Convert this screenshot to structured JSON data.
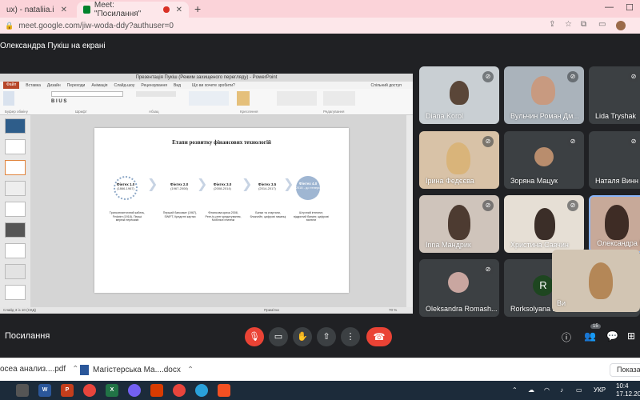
{
  "browser": {
    "tabs": [
      {
        "label": "ux) - nataliia.ilnytska@"
      },
      {
        "label": "Meet: \"Посилання\""
      }
    ],
    "url": "meet.google.com/jiw-woda-ddy?authuser=0"
  },
  "meet": {
    "presenter_label": "Олександра Пукіш на екрані",
    "meeting_name": "Посилання",
    "people_count": "15"
  },
  "powerpoint": {
    "window_title": "Презентація Пукіш (Режим захищеного перегляду) - PowerPoint",
    "tabs": [
      "Файл",
      "Вставка",
      "Дизайн",
      "Переходи",
      "Анімація",
      "Слайд-шоу",
      "Рецензування",
      "Вид"
    ],
    "tell_me": "Що ви хочете зробити?",
    "share_label": "Спільний доступ",
    "ribbon_groups": [
      "Буфер обміну",
      "Шрифт",
      "Абзац",
      "Креслення",
      "Редагування"
    ],
    "slide_title": "Етапи розвитку фінансових технологій",
    "phases": [
      {
        "name": "Фінтех 1.0",
        "years": "(1866-1967)"
      },
      {
        "name": "Фінтех 2.0",
        "years": "(1967-2008)"
      },
      {
        "name": "Фінтех 3.0",
        "years": "(2008-2014)"
      },
      {
        "name": "Фінтех 3.5",
        "years": "(2014-2017)"
      },
      {
        "name": "Фінтех 4.0",
        "years": "(2018 - до теперь)"
      }
    ],
    "descriptions": [
      "Трансатлантичний кабель, Fedwire (1918), Перші мережі переказів",
      "Перший банкомат (1967), SWIFT, Кредитні картки",
      "Фінансова криза 2008, Peer-to-peer кредитування, Мобільні платежі",
      "Банки та стартапи, блокчейн, цифрові гаманці",
      "Штучний інтелект, відкритий банкінг, цифрові валюти"
    ],
    "status_left": "Слайд 3 із 10 (СКД)",
    "status_right": "Примітки",
    "zoom": "70 %"
  },
  "participants": [
    {
      "name": "Diana Korol",
      "muted": true
    },
    {
      "name": "Вульчин Роман Дм...",
      "muted": true
    },
    {
      "name": "Lida Tryshak",
      "muted": true
    },
    {
      "name": "Ірина Федєєва",
      "muted": true
    },
    {
      "name": "Зоряна Мацук",
      "muted": true
    },
    {
      "name": "Наталя Винн",
      "muted": true
    },
    {
      "name": "Іnna Мандрик",
      "muted": true
    },
    {
      "name": "Христина Савчин",
      "muted": true
    },
    {
      "name": "Олександра П",
      "muted": false
    },
    {
      "name": "Oleksandra Romash...",
      "muted": true
    },
    {
      "name": "Rorksolyana L",
      "muted": true,
      "initial": "R"
    },
    {
      "name": "Ви",
      "muted": false
    }
  ],
  "downloads": [
    {
      "label": "ocea анализ....pdf"
    },
    {
      "label": "Магістерська Ма....docx"
    }
  ],
  "downloads_show_all": "Показати",
  "taskbar": {
    "lang": "УКР",
    "time": "10:4",
    "date": "17.12.20"
  },
  "colors": {
    "meet_bg": "#202124",
    "hangup": "#ea4335",
    "chrome_tab": "#fbd3d9",
    "taskbar": "#1c2b3a"
  }
}
